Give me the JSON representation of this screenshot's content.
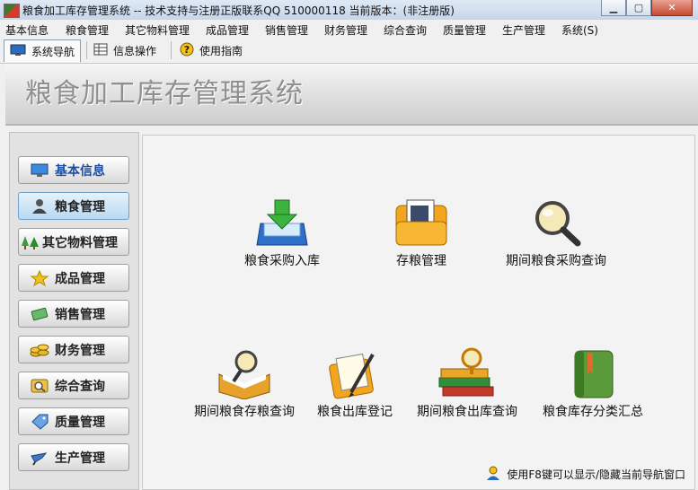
{
  "window": {
    "title": "粮食加工库存管理系统 -- 技术支持与注册正版联系QQ 510000118    当前版本：(非注册版)",
    "min_glyph": "▁",
    "max_glyph": "▢",
    "close_glyph": "✕"
  },
  "menu": [
    "基本信息",
    "粮食管理",
    "其它物料管理",
    "成品管理",
    "销售管理",
    "财务管理",
    "综合查询",
    "质量管理",
    "生产管理",
    "系统(S)"
  ],
  "tabs": [
    {
      "label": "系统导航",
      "icon": "monitor-icon"
    },
    {
      "label": "信息操作",
      "icon": "grid-icon"
    },
    {
      "label": "使用指南",
      "icon": "help-icon"
    }
  ],
  "banner": {
    "title": "粮食加工库存管理系统"
  },
  "sidebar": {
    "active_index": 1,
    "items": [
      {
        "label": "基本信息",
        "icon": "monitor-icon"
      },
      {
        "label": "粮食管理",
        "icon": "user-icon"
      },
      {
        "label": "其它物料管理",
        "icon": "trees-icon"
      },
      {
        "label": "成品管理",
        "icon": "star-icon"
      },
      {
        "label": "销售管理",
        "icon": "money-icon"
      },
      {
        "label": "财务管理",
        "icon": "coins-icon"
      },
      {
        "label": "综合查询",
        "icon": "search-doc-icon"
      },
      {
        "label": "质量管理",
        "icon": "tag-icon"
      },
      {
        "label": "生产管理",
        "icon": "pen-icon"
      }
    ]
  },
  "functions": [
    {
      "label": "粮食采购入库",
      "icon": "inbox-download-icon"
    },
    {
      "label": "存粮管理",
      "icon": "folder-doc-icon"
    },
    {
      "label": "期间粮食采购查询",
      "icon": "magnifier-icon"
    },
    {
      "label": "期间粮食存粮查询",
      "icon": "book-magnifier-icon"
    },
    {
      "label": "粮食出库登记",
      "icon": "folder-pen-icon"
    },
    {
      "label": "期间粮食出库查询",
      "icon": "books-magnifier-icon"
    },
    {
      "label": "粮食库存分类汇总",
      "icon": "green-book-icon"
    }
  ],
  "hint": {
    "text": "使用F8键可以显示/隐藏当前导航窗口",
    "icon": "user-help-icon"
  },
  "colors": {
    "accent": "#1c4d9c",
    "active_nav": "#b9d9f1",
    "banner_text": "#8f8f8f"
  }
}
